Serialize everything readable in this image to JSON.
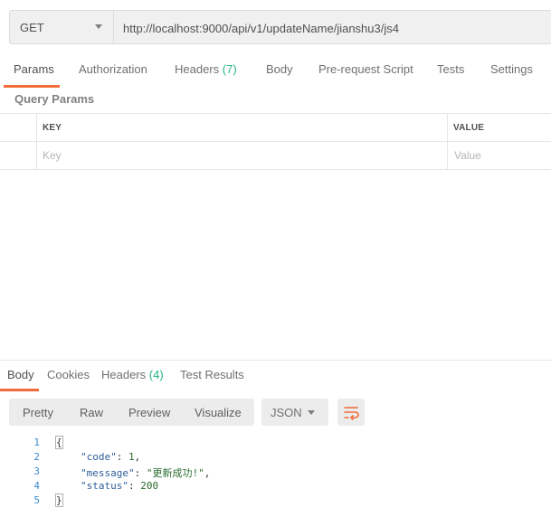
{
  "request": {
    "method": "GET",
    "url": "http://localhost:9000/api/v1/updateName/jianshu3/js4"
  },
  "request_tabs": [
    {
      "label": "Params",
      "count": ""
    },
    {
      "label": "Authorization",
      "count": ""
    },
    {
      "label": "Headers",
      "count": "(7)"
    },
    {
      "label": "Body",
      "count": ""
    },
    {
      "label": "Pre-request Script",
      "count": ""
    },
    {
      "label": "Tests",
      "count": ""
    },
    {
      "label": "Settings",
      "count": ""
    }
  ],
  "query_params": {
    "title": "Query Params",
    "columns": {
      "key": "KEY",
      "value": "VALUE"
    },
    "placeholders": {
      "key": "Key",
      "value": "Value"
    }
  },
  "response_tabs": [
    {
      "label": "Body",
      "count": ""
    },
    {
      "label": "Cookies",
      "count": ""
    },
    {
      "label": "Headers",
      "count": "(4)"
    },
    {
      "label": "Test Results",
      "count": ""
    }
  ],
  "view_modes": [
    "Pretty",
    "Raw",
    "Preview",
    "Visualize"
  ],
  "format": "JSON",
  "icons": {
    "method_dropdown": "chevron-down-icon",
    "format_dropdown": "chevron-down-icon",
    "wrap": "wrap-lines-icon"
  },
  "colors": {
    "accent": "#f26b3a",
    "count": "#26b47f"
  },
  "response_body": {
    "line_numbers": [
      "1",
      "2",
      "3",
      "4",
      "5"
    ],
    "open_brace": "{",
    "close_brace": "}",
    "fields": [
      {
        "key": "\"code\"",
        "sep": ": ",
        "value": "1",
        "trail": ","
      },
      {
        "key": "\"message\"",
        "sep": ": ",
        "value": "\"更新成功!\"",
        "trail": ","
      },
      {
        "key": "\"status\"",
        "sep": ": ",
        "value": "200",
        "trail": ""
      }
    ]
  }
}
